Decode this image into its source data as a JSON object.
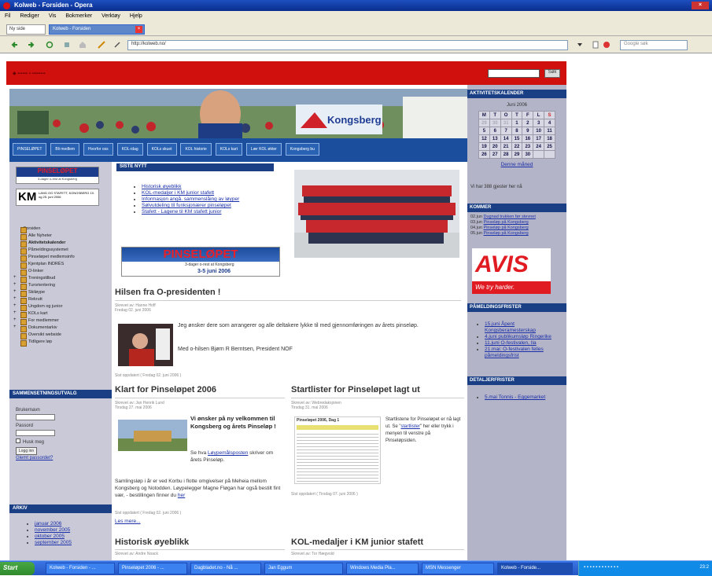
{
  "window": {
    "title": "Kolweb - Forsiden - Opera"
  },
  "menu": [
    "Fil",
    "Rediger",
    "Vis",
    "Bokmerker",
    "Verktøy",
    "Hjelp"
  ],
  "tabs": [
    {
      "label": "Ny side"
    },
    {
      "label": "Kolweb - Forsiden"
    }
  ],
  "address": {
    "url": "http://kolweb.no/",
    "search_placeholder": "Google søk"
  },
  "site": {
    "search_button": "Søk",
    "nav": [
      "PINSELØPET",
      "Bli medlem",
      "Hvorfor oss",
      "KOL-idag",
      "KOLs skuet",
      "KOL historie",
      "KOLs kart",
      "Lær KOL økter",
      "Kongsberg bu"
    ],
    "banner_text": "Kongsberg",
    "left_tree": [
      "Forsiden",
      "Alle Nyheter",
      "Aktivitetskalender",
      "Påmeldingssystemet",
      "Pinseløpet medlemsinfo",
      "Kjentplan INDRÉS",
      "O-linker",
      "Treningstilbud",
      "Turorientering",
      "Skiløype",
      "Rekrutt",
      "Ungdom og junior",
      "KOLs kart",
      "For medlemmer",
      "Dokumentarkiv",
      "Oversikt webside",
      "Tidligere løp"
    ],
    "login": {
      "heading": "SAMMENSETNINGSUTVALG",
      "username_label": "Brukernavn",
      "password_label": "Passord",
      "remember_label": "Husk meg",
      "login_button": "Logg inn",
      "forgot_link": "Glemt passordet?"
    },
    "archive": {
      "heading": "ARKIV",
      "items": [
        "januar 2006",
        "november 2005",
        "oktober 2005",
        "september 2005"
      ]
    },
    "news": {
      "heading": "SISTE NYTT",
      "items": [
        "Historisk øyeblikk",
        "KOL-medaljer i KM junior stafett",
        "Informasjon angå. sammenslåing av løyper",
        "Sølvutdeling til funksjonærer pinseløpet",
        "Stafett - Lagene til KM stafett junior"
      ]
    },
    "article1": {
      "title": "Hilsen fra O-presidenten !",
      "meta": "Skrevet av: Hanne Hoff",
      "date": "Fredag 02. juni 2006",
      "body": "Jeg ønsker dere som arrangerer og alle deltakere lykke til med gjennomføringen av årets pinseløp.",
      "signoff": "Med o-hilsen Bjørn R Berntsen, President NOF",
      "updated": "Sist oppdatert ( Fredag 02. juni 2006 )"
    },
    "article2": {
      "title": "Klart for Pinseløpet 2006",
      "meta": "Skrevet av: Jan Henrik Lund",
      "date": "Tirsdag 27. mai 2006",
      "headline": "Vi ønsker på ny velkommen til Kongsberg og årets Pinseløp !",
      "link_pre": "Se hva ",
      "link": "Løypemålsposten",
      "link_post": " skriver om årets Pinseløp.",
      "body": "Samlingsløp i år er ved Korbu i flotte omgivelser på Meheia mellom Kongsberg og Notodden. Løypelegger Magne Fløgan har også bestilt fint vær, - bestillingen finner du ",
      "here": "her",
      "updated": "Sist oppdatert ( Fredag 02. juni 2006 )",
      "more": "Les mere..."
    },
    "article3": {
      "title": "Startlister for Pinseløpet lagt ut",
      "meta": "Skrevet av: Webredaksjonen",
      "date": "Tirsdag 31. mai 2006",
      "body_pre": "Startlistene for Pinseløpet er nå lagt ut. Se \"",
      "link": "startlister",
      "body_post": "\" her eller trykk i menyen til venstre på Pinseløpsiden.",
      "updated": "Sist oppdatert ( Tirsdag 07. juni 2006 )",
      "thumb_title": "Pinseløpet 2006, Dag 1"
    },
    "article4": {
      "title": "Historisk øyeblikk",
      "meta": "Skrevet av: Andre Noack"
    },
    "article5": {
      "title": "KOL-medaljer i KM junior stafett",
      "meta": "Skrevet av: Tor Hægvold"
    },
    "pinselopet_banner": {
      "title": "PINSELØPET",
      "sub": "3-dager o-rest at Kongsberg",
      "date": "3-5 juni 2006"
    },
    "km_banner": {
      "big": "KM",
      "text": "LANG OG STAFETT, KONGSBERG 10. og 25. juni 2006"
    },
    "calendar": {
      "heading": "AKTIVITETSKALENDER",
      "month": "Juni 2006",
      "days": [
        "M",
        "T",
        "O",
        "T",
        "F",
        "L",
        "S"
      ],
      "weeks": [
        [
          "29",
          "30",
          "31",
          "1",
          "2",
          "3",
          "4"
        ],
        [
          "5",
          "6",
          "7",
          "8",
          "9",
          "10",
          "11"
        ],
        [
          "12",
          "13",
          "14",
          "15",
          "16",
          "17",
          "18"
        ],
        [
          "19",
          "20",
          "21",
          "22",
          "23",
          "24",
          "25"
        ],
        [
          "26",
          "27",
          "28",
          "29",
          "30",
          "",
          ""
        ]
      ],
      "this_month": "Denne måned"
    },
    "guests": "Vi har 388 gjester her nå",
    "coming": {
      "heading": "KOMMER",
      "items": [
        {
          "date": "02.jun",
          "text": "Dugnad trukken før stevnet"
        },
        {
          "date": "03.jun",
          "text": "Pinseløp på Kongsberg"
        },
        {
          "date": "04.jun",
          "text": "Pinseløp på Kongsberg"
        },
        {
          "date": "05.jun",
          "text": "Pinseløp på Kongsberg"
        }
      ]
    },
    "avis": {
      "big": "AVIS",
      "sub": "We try harder."
    },
    "signup": {
      "heading": "PÅMELDINGSFRISTER",
      "items": [
        "15.juni Åpent Kongsberamesterskap",
        "4.juni publikumsløp Ringerike",
        "11.juni O-festivalen, Ila",
        "21.mai: O-festivalen felles påmeldingsfrist"
      ]
    },
    "deadlines": {
      "heading": "DETALJERFRISTER",
      "items": [
        "5.mai Tonnis - Eggemarket"
      ]
    }
  },
  "taskbar": {
    "start": "Start",
    "tasks": [
      "Kolweb - Forsiden - ...",
      "Pinseløpet 2006 - ...",
      "Dagbladet.no - Nå ...",
      "Jan Eggum",
      "Windows Media Pla...",
      "MSN Messenger",
      "Kolweb - Forside..."
    ],
    "clock": "23:2"
  },
  "colors": {
    "red": "#d0100c",
    "navy": "#1a3f84",
    "panel": "#b4b4c8",
    "left": "#c9c9d8"
  }
}
